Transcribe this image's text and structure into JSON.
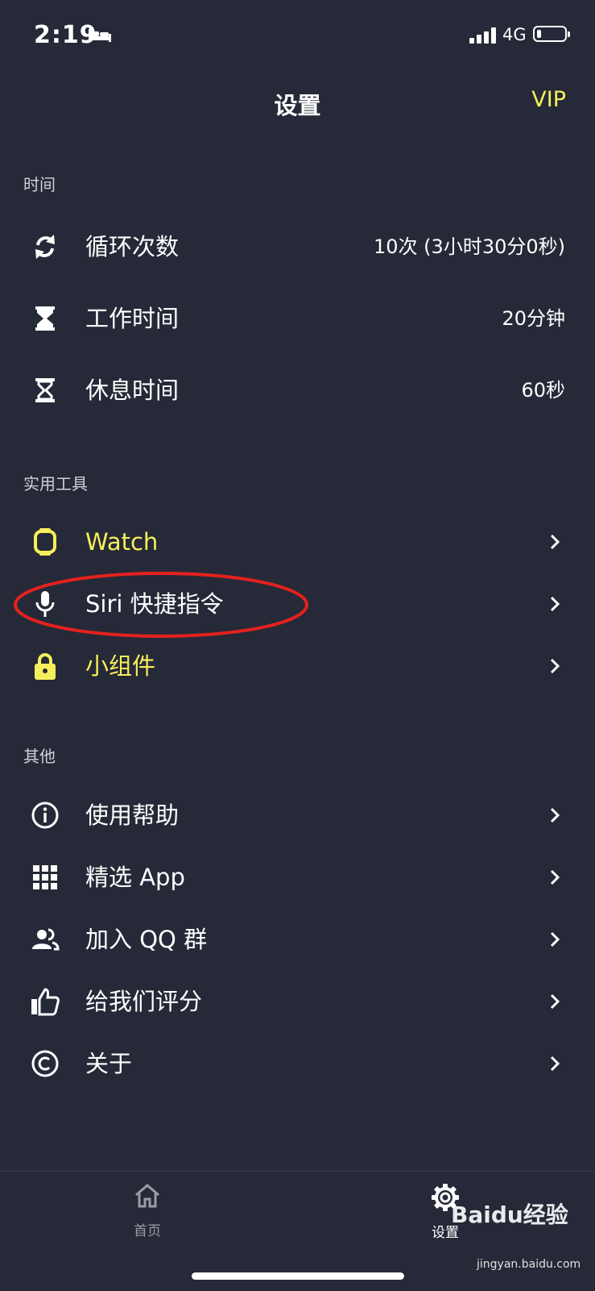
{
  "status_bar": {
    "time": "2:19",
    "network": "4G"
  },
  "nav": {
    "title": "设置",
    "vip": "VIP"
  },
  "sections": [
    {
      "title": "时间",
      "items": [
        {
          "label": "循环次数",
          "value": "10次 (3小时30分0秒)",
          "icon": "repeat-icon"
        },
        {
          "label": "工作时间",
          "value": "20分钟",
          "icon": "hourglass-full-icon"
        },
        {
          "label": "休息时间",
          "value": "60秒",
          "icon": "hourglass-empty-icon"
        }
      ]
    },
    {
      "title": "实用工具",
      "items": [
        {
          "label": "Watch",
          "icon": "watch-icon",
          "color": "#f6ef5a"
        },
        {
          "label": "Siri 快捷指令",
          "icon": "microphone-icon"
        },
        {
          "label": "小组件",
          "icon": "lock-icon",
          "color": "#f6ef5a"
        }
      ]
    },
    {
      "title": "其他",
      "items": [
        {
          "label": "使用帮助",
          "icon": "info-icon"
        },
        {
          "label": "精选 App",
          "icon": "grid-icon"
        },
        {
          "label": "加入 QQ 群",
          "icon": "people-icon"
        },
        {
          "label": "给我们评分",
          "icon": "thumbs-up-icon"
        },
        {
          "label": "关于",
          "icon": "copyright-icon"
        }
      ]
    }
  ],
  "tabbar": {
    "home": "首页",
    "settings": "设置"
  },
  "watermark": {
    "text": "Baidu经验",
    "url": "jingyan.baidu.com"
  },
  "colors": {
    "background": "#262937",
    "accent": "#f6ef5a",
    "annotation": "#e3211d"
  }
}
